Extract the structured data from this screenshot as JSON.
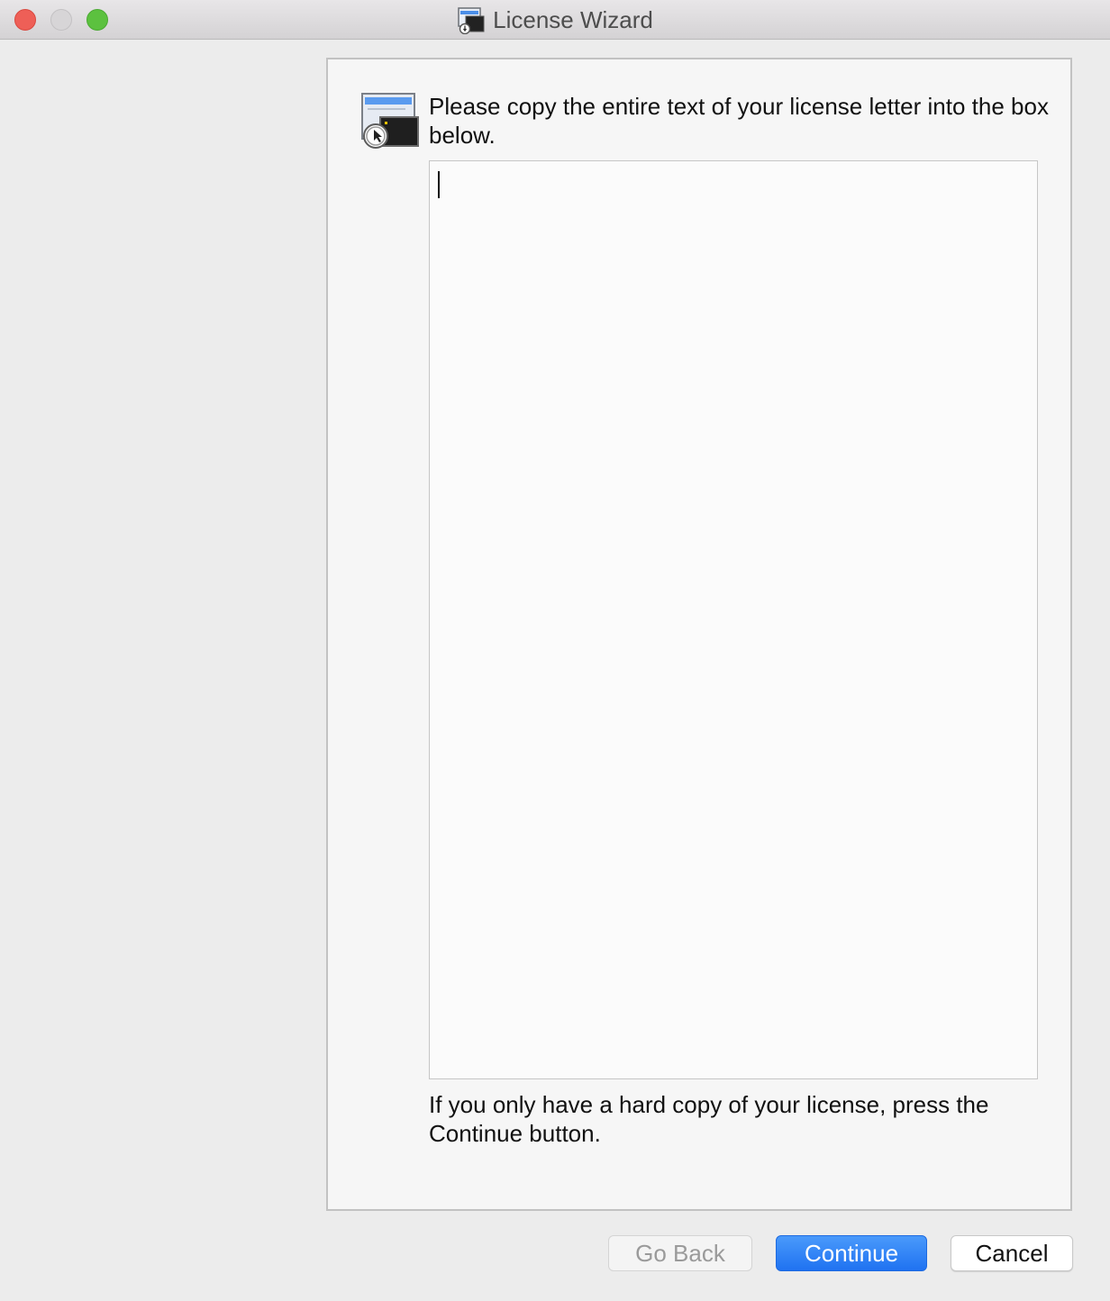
{
  "window": {
    "title": "License Wizard",
    "title_icon": "license-wizard-app-icon"
  },
  "panel": {
    "icon": "license-wizard-icon",
    "instruction": "Please copy the entire text of your license letter into the box below.",
    "license_text": {
      "value": "",
      "placeholder": ""
    },
    "footnote": "If you only have a hard copy of your license, press the Continue button."
  },
  "buttons": {
    "go_back": "Go Back",
    "continue": "Continue",
    "cancel": "Cancel"
  },
  "colors": {
    "accent": "#1f72f1",
    "close": "#ee5f57",
    "zoom": "#5cc13f"
  }
}
